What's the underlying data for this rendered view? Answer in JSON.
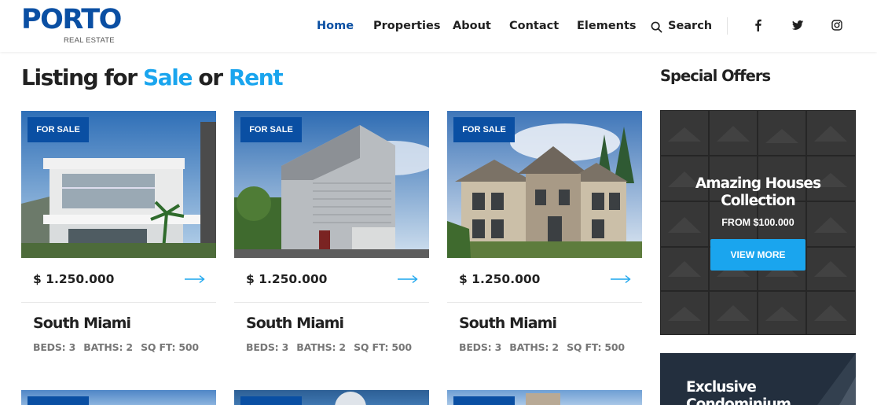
{
  "brand": {
    "logo_text": "PORTO",
    "logo_sub": "REAL ESTATE",
    "primary": "#0a4fa3",
    "accent": "#1aa5ee"
  },
  "nav": {
    "items": [
      {
        "label": "Home",
        "active": true
      },
      {
        "label": "Properties",
        "active": false
      },
      {
        "label": "About",
        "active": false
      },
      {
        "label": "Contact",
        "active": false
      },
      {
        "label": "Elements",
        "active": false
      },
      {
        "label": "Search",
        "active": false,
        "icon": "search-icon"
      }
    ],
    "social": [
      "facebook-icon",
      "twitter-icon",
      "instagram-icon"
    ]
  },
  "listing": {
    "title_part1": "Listing for ",
    "title_sale": "Sale",
    "title_mid": " or ",
    "title_rent": "Rent"
  },
  "cards": [
    {
      "badge": "FOR SALE",
      "price": "$ 1.250.000",
      "name": "South Miami",
      "beds": "BEDS: 3",
      "baths": "BATHS: 2",
      "sqft": "SQ FT: 500"
    },
    {
      "badge": "FOR SALE",
      "price": "$ 1.250.000",
      "name": "South Miami",
      "beds": "BEDS: 3",
      "baths": "BATHS: 2",
      "sqft": "SQ FT: 500"
    },
    {
      "badge": "FOR SALE",
      "price": "$ 1.250.000",
      "name": "South Miami",
      "beds": "BEDS: 3",
      "baths": "BATHS: 2",
      "sqft": "SQ FT: 500"
    }
  ],
  "sidebar": {
    "title": "Special Offers",
    "offer1": {
      "title_line1": "Amazing Houses",
      "title_line2": "Collection",
      "subtitle": "FROM $100.000",
      "button": "VIEW MORE"
    },
    "offer2": {
      "title_line1": "Exclusive",
      "title_line2": "Condominium"
    }
  }
}
